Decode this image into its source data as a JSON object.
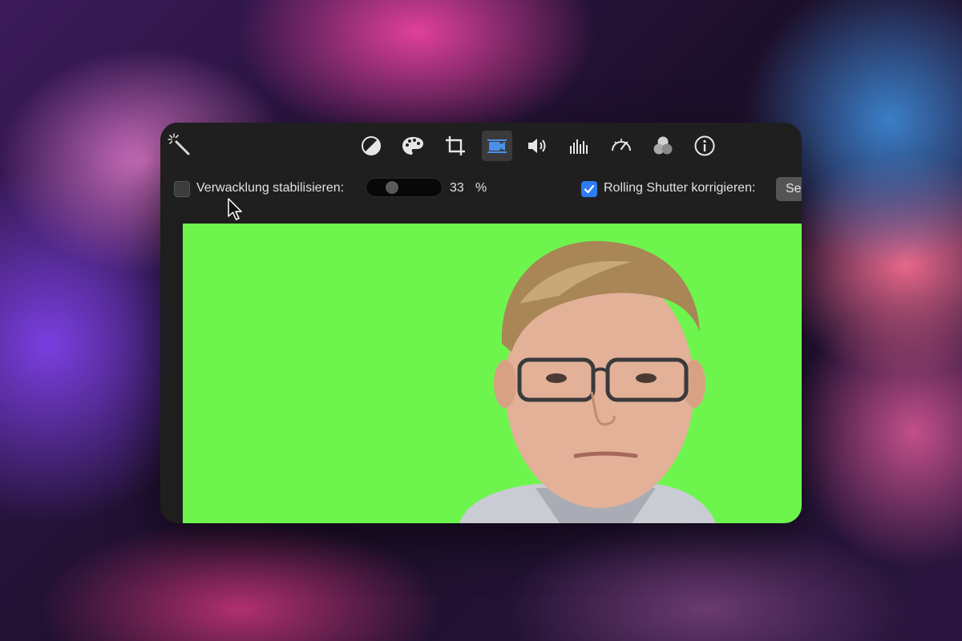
{
  "toolbar": {
    "wand_icon": "magic-wand-icon",
    "tools": [
      {
        "name": "color-balance",
        "icon": "half-circle-icon"
      },
      {
        "name": "color-correction",
        "icon": "palette-icon"
      },
      {
        "name": "crop",
        "icon": "crop-icon"
      },
      {
        "name": "stabilization",
        "icon": "video-camera-icon",
        "active": true
      },
      {
        "name": "volume",
        "icon": "speaker-icon"
      },
      {
        "name": "equalizer",
        "icon": "equalizer-icon"
      },
      {
        "name": "speed",
        "icon": "speedometer-icon"
      },
      {
        "name": "filter",
        "icon": "overlapping-circles-icon"
      },
      {
        "name": "info",
        "icon": "info-icon"
      }
    ],
    "active_color": "#4a90e8"
  },
  "stabilization": {
    "checkbox_checked": false,
    "label": "Verwacklung stabilisieren:",
    "slider_value": "33",
    "slider_unit": "%"
  },
  "rolling_shutter": {
    "checkbox_checked": true,
    "label": "Rolling Shutter korrigieren:",
    "button_label": "Se"
  },
  "viewer": {
    "background_color": "#6ef54d"
  },
  "cursor_icon": "mouse-pointer-icon"
}
